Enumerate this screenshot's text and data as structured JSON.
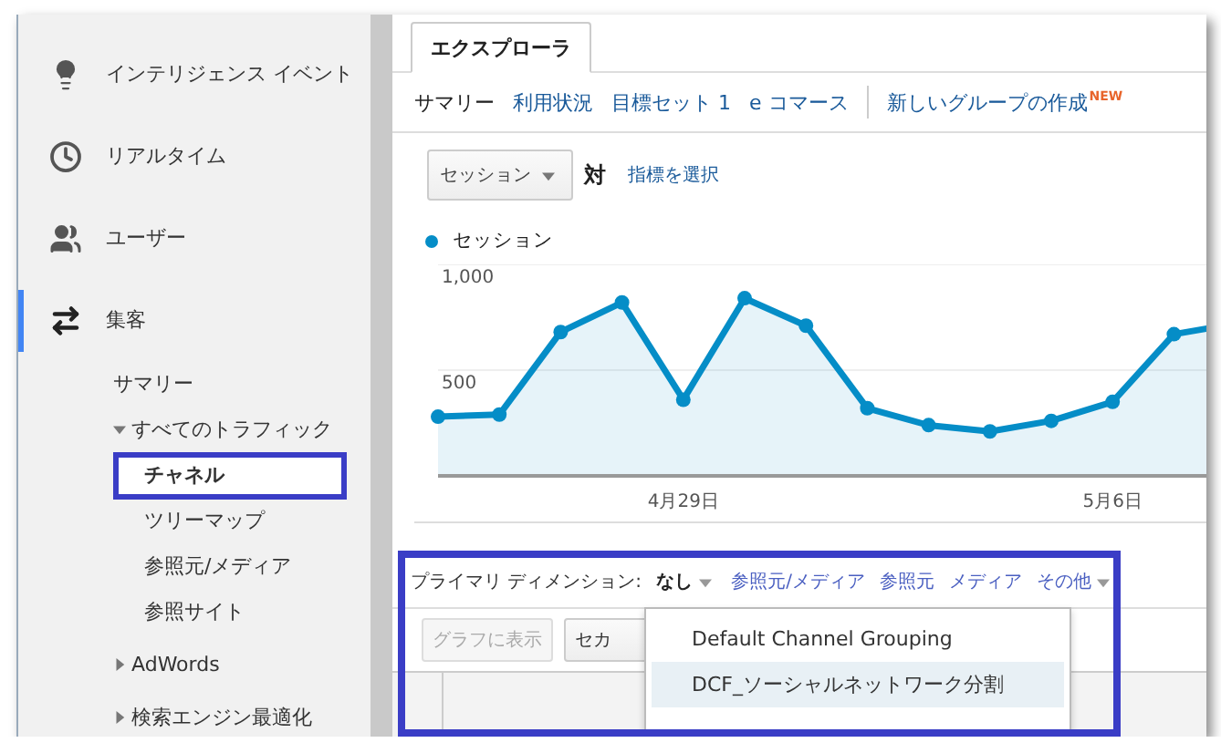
{
  "sidebar": {
    "items": [
      {
        "kind": "bulb",
        "label": "インテリジェンス イベント",
        "selected": false
      },
      {
        "kind": "clock",
        "label": "リアルタイム",
        "selected": false
      },
      {
        "kind": "people",
        "label": "ユーザー",
        "selected": false
      },
      {
        "kind": "arrows",
        "label": "集客",
        "selected": true,
        "children": [
          {
            "label": "サマリー",
            "selected": false
          },
          {
            "label": "すべてのトラフィック",
            "expanded": true,
            "selected": false,
            "children": [
              {
                "label": "チャネル",
                "selected": true,
                "highlighted": true
              },
              {
                "label": "ツリーマップ",
                "selected": false,
                "highlighted": false
              },
              {
                "label": "参照元/メディア",
                "selected": false,
                "highlighted": false
              },
              {
                "label": "参照サイト",
                "selected": false,
                "highlighted": false
              }
            ]
          },
          {
            "label": "AdWords",
            "expanded": false,
            "selected": false
          },
          {
            "label": "検索エンジン最適化",
            "expanded": false,
            "selected": false
          }
        ]
      }
    ]
  },
  "tabs": [
    {
      "label": "エクスプローラ",
      "selected": true
    }
  ],
  "subnav": [
    {
      "label": "サマリー",
      "selected": true
    },
    {
      "label": "利用状況",
      "selected": false
    },
    {
      "label": "目標セット 1",
      "selected": false
    },
    {
      "label": "e コマース",
      "selected": false
    }
  ],
  "new_group_link": {
    "label": "新しいグループの作成",
    "badge": "NEW"
  },
  "metric_selector": {
    "value": "セッション"
  },
  "vs_label": "対",
  "select_metric_link": "指標を選択",
  "chart_data": {
    "type": "area",
    "series": [
      {
        "name": "セッション",
        "color": "#058dc7",
        "values": [
          280,
          290,
          680,
          820,
          360,
          840,
          710,
          320,
          240,
          210,
          260,
          350,
          670,
          720
        ]
      }
    ],
    "categories": [
      null,
      null,
      null,
      null,
      "4月29日",
      null,
      null,
      null,
      null,
      null,
      null,
      "5月6日",
      null,
      null
    ],
    "ylim": [
      0,
      1000
    ],
    "yticks": [
      {
        "value": 500,
        "label": "500"
      },
      {
        "value": 1000,
        "label": "1,000"
      }
    ]
  },
  "dimension_panel": {
    "highlighted": true,
    "label": "プライマリ ディメンション:",
    "options": [
      {
        "kind": "dropdown",
        "label": "なし",
        "selected": true
      },
      {
        "kind": "link",
        "label": "参照元/メディア",
        "selected": false
      },
      {
        "kind": "link",
        "label": "参照元",
        "selected": false
      },
      {
        "kind": "link",
        "label": "メディア",
        "selected": false
      },
      {
        "kind": "dropdown",
        "label": "その他",
        "selected": false
      }
    ],
    "toolbar": [
      {
        "kind": "button",
        "label": "グラフに表示",
        "disabled": true
      },
      {
        "kind": "dropdown",
        "label": "セカ",
        "disabled": false
      }
    ],
    "menu": {
      "items": [
        {
          "label": "Default Channel Grouping",
          "selected": false
        },
        {
          "label": "DCF_ソーシャルネットワーク分割",
          "selected": true
        }
      ]
    }
  }
}
